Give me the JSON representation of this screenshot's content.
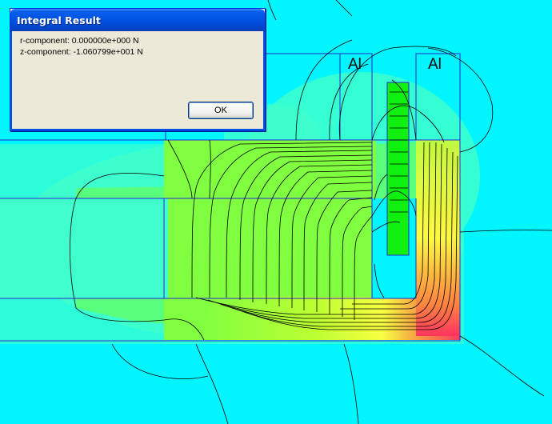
{
  "colors": {
    "background": "#00f5ff",
    "field_low": "#40ffcc",
    "field_mid": "#80ff40",
    "field_high": "#ffff40",
    "field_peak": "#ff3060",
    "coil": "#10f010",
    "region_outline": "#2a2ad0",
    "contour": "#000000",
    "dialog_title": "#0054e3"
  },
  "region_labels": {
    "inner_aluminum": "Al",
    "outer_aluminum": "Al"
  },
  "dialog": {
    "title": "Integral Result",
    "r_component": "r-component: 0.000000e+000 N",
    "z_component": "z-component: -1.060799e+001 N",
    "ok_label": "OK"
  }
}
